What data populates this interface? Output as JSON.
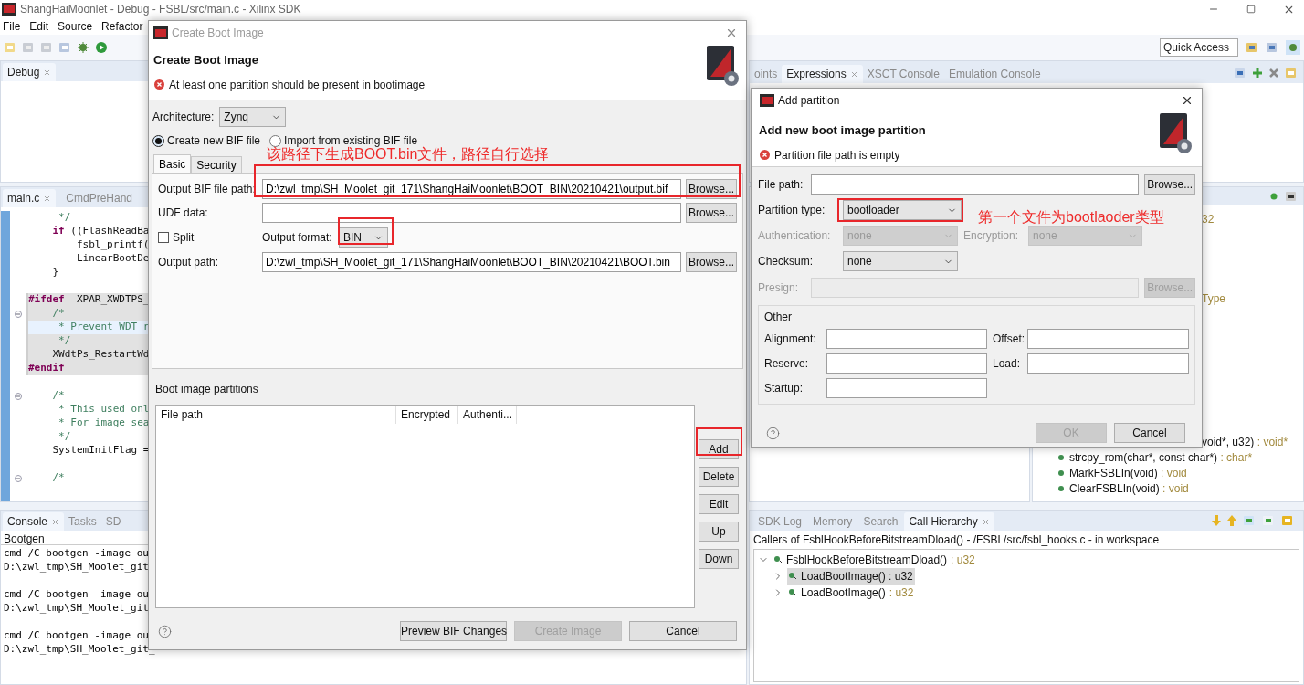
{
  "window": {
    "title": "ShangHaiMoonlet - Debug - FSBL/src/main.c - Xilinx SDK"
  },
  "menu": [
    "File",
    "Edit",
    "Source",
    "Refactor"
  ],
  "quick_access": {
    "placeholder": "Quick Access"
  },
  "debug_view": {
    "tabs": [
      {
        "label": "Debug",
        "selected": true
      }
    ]
  },
  "editor": {
    "tabs": [
      {
        "label": "main.c",
        "selected": true
      },
      {
        "label": "CmdPreHand",
        "selected": false
      }
    ],
    "lines": [
      {
        "text": "     */",
        "kind": "comment",
        "shaded": false,
        "current": false,
        "fold": false
      },
      {
        "text": "    **if** ((FlashReadBa",
        "kind": "code",
        "shaded": false,
        "current": false,
        "fold": false
      },
      {
        "text": "        fsbl_printf(",
        "kind": "code",
        "shaded": false,
        "current": false,
        "fold": false
      },
      {
        "text": "        LinearBootDe",
        "kind": "code",
        "shaded": false,
        "current": false,
        "fold": false
      },
      {
        "text": "    }",
        "kind": "code",
        "shaded": false,
        "current": false,
        "fold": false
      },
      {
        "shaded": false,
        "current": false,
        "fold": false
      },
      {
        "text": "**#ifdef**  XPAR_XWDTPS_",
        "kind": "code",
        "shaded": true,
        "current": false,
        "fold": false
      },
      {
        "text": "    /*",
        "kind": "comment",
        "shaded": true,
        "current": false,
        "fold": true
      },
      {
        "text": "     * Prevent WDT r",
        "kind": "comment",
        "shaded": true,
        "current": true,
        "fold": false
      },
      {
        "text": "     */",
        "kind": "comment",
        "shaded": true,
        "current": false,
        "fold": false
      },
      {
        "text": "    XWdtPs_RestartWd",
        "kind": "code",
        "shaded": true,
        "current": false,
        "fold": false
      },
      {
        "text": "#endif",
        "kind": "directive",
        "shaded": true,
        "current": false,
        "fold": false
      },
      {
        "shaded": false,
        "current": false,
        "fold": false
      },
      {
        "text": "    /*",
        "kind": "comment",
        "shaded": false,
        "current": false,
        "fold": true
      },
      {
        "text": "     * This used onl",
        "kind": "comment",
        "shaded": false,
        "current": false,
        "fold": false
      },
      {
        "text": "     * For image sea",
        "kind": "comment",
        "shaded": false,
        "current": false,
        "fold": false
      },
      {
        "text": "     */",
        "kind": "comment",
        "shaded": false,
        "current": false,
        "fold": false
      },
      {
        "text": "    SystemInitFlag =",
        "kind": "code",
        "shaded": false,
        "current": false,
        "fold": false
      },
      {
        "shaded": false,
        "current": false,
        "fold": false
      },
      {
        "text": "    /*",
        "kind": "comment",
        "shaded": false,
        "current": false,
        "fold": true
      }
    ]
  },
  "console": {
    "tabs": [
      {
        "label": "Console",
        "selected": true
      },
      {
        "label": "Tasks",
        "selected": false
      },
      {
        "label": "SD",
        "selected": false
      }
    ],
    "title": "Bootgen",
    "entries": [
      {
        "command": "cmd /C bootgen -image ou",
        "path": "D:\\zwl_tmp\\SH_Moolet_git"
      },
      {
        "command": "cmd /C bootgen -image ou",
        "path": "D:\\zwl_tmp\\SH_Moolet_git"
      },
      {
        "command": "cmd /C bootgen -image ou",
        "path": "D:\\zwl_tmp\\SH_Moolet_git_"
      }
    ]
  },
  "expressions": {
    "tabs": [
      {
        "label": "oints",
        "selected": false
      },
      {
        "label": "Expressions",
        "selected": true
      },
      {
        "label": "XSCT Console",
        "selected": false
      },
      {
        "label": "Emulation Console",
        "selected": false
      }
    ]
  },
  "outline": {
    "rows": [
      {
        "type": "32",
        "kind": "fragment"
      },
      {
        "type": "Type",
        "kind": "fragment"
      },
      {
        "name": "void*, u32)",
        "type": ": void*",
        "kind": "fragment"
      },
      {
        "name": "strcpy_rom(char*, const char*)",
        "type": ": char*",
        "kind": "method"
      },
      {
        "name": "MarkFSBLIn(void)",
        "type": ": void",
        "kind": "method"
      },
      {
        "name": "ClearFSBLIn(void)",
        "type": ": void",
        "kind": "method"
      }
    ]
  },
  "call_hierarchy": {
    "tabs": [
      {
        "label": "SDK Log",
        "selected": false
      },
      {
        "label": "Memory",
        "selected": false
      },
      {
        "label": "Search",
        "selected": false
      },
      {
        "label": "Call Hierarchy",
        "selected": true
      }
    ],
    "header": "Callers of FsblHookBeforeBitstreamDload() - /FSBL/src/fsbl_hooks.c - in workspace",
    "tree": [
      {
        "name": "FsblHookBeforeBitstreamDload()",
        "type": ": u32",
        "expanded": true,
        "selected": false,
        "children": [
          {
            "name": "LoadBootImage() : u32",
            "expanded": false,
            "selected": true
          },
          {
            "name": "LoadBootImage()",
            "type": ": u32",
            "expanded": false,
            "selected": false
          }
        ]
      }
    ]
  },
  "create_boot_image": {
    "title": "Create Boot Image",
    "heading": "Create Boot Image",
    "error": "At least one partition should be present in bootimage",
    "architecture": {
      "label": "Architecture:",
      "value": "Zynq"
    },
    "bif_options": [
      {
        "label": "Create new BIF file",
        "selected": true
      },
      {
        "label": "Import from existing BIF file",
        "selected": false
      }
    ],
    "tabs": [
      {
        "label": "Basic",
        "selected": true
      },
      {
        "label": "Security",
        "selected": false
      }
    ],
    "output_bif": {
      "label": "Output BIF file path:",
      "value": "D:\\zwl_tmp\\SH_Moolet_git_171\\ShangHaiMoonlet\\BOOT_BIN\\20210421\\output.bif",
      "button": "Browse..."
    },
    "udf": {
      "label": "UDF data:",
      "button": "Browse..."
    },
    "split": {
      "label": "Split",
      "checked": false
    },
    "output_format": {
      "label": "Output format:",
      "value": "BIN"
    },
    "output_path": {
      "label": "Output path:",
      "value": "D:\\zwl_tmp\\SH_Moolet_git_171\\ShangHaiMoonlet\\BOOT_BIN\\20210421\\BOOT.bin",
      "button": "Browse..."
    },
    "partitions": {
      "label": "Boot image partitions",
      "columns": [
        "File path",
        "Encrypted",
        "Authenti..."
      ],
      "buttons": [
        "Add",
        "Delete",
        "Edit",
        "Up",
        "Down"
      ]
    },
    "footer_buttons": [
      {
        "label": "Preview BIF Changes",
        "disabled": false
      },
      {
        "label": "Create Image",
        "disabled": true
      },
      {
        "label": "Cancel",
        "disabled": false
      }
    ]
  },
  "add_partition": {
    "title": "Add partition",
    "heading": "Add new boot image partition",
    "error": "Partition file path is empty",
    "file_path": {
      "label": "File path:",
      "button": "Browse..."
    },
    "partition_type": {
      "label": "Partition type:",
      "value": "bootloader"
    },
    "authentication": {
      "label": "Authentication:",
      "value": "none",
      "disabled": true
    },
    "encryption": {
      "label": "Encryption:",
      "value": "none",
      "disabled": true
    },
    "checksum": {
      "label": "Checksum:",
      "value": "none",
      "disabled": false
    },
    "presign": {
      "label": "Presign:",
      "button": "Browse...",
      "disabled": true
    },
    "other": {
      "title": "Other",
      "fields": [
        {
          "label": "Alignment:"
        },
        {
          "label": "Offset:"
        },
        {
          "label": "Reserve:"
        },
        {
          "label": "Load:"
        },
        {
          "label": "Startup:"
        }
      ]
    },
    "buttons": [
      {
        "label": "OK",
        "disabled": true
      },
      {
        "label": "Cancel",
        "disabled": false
      }
    ]
  },
  "annotations": [
    {
      "text": "该路径下生成BOOT.bin文件，路径自行选择"
    },
    {
      "text": "第一个文件为bootlaoder类型"
    }
  ]
}
